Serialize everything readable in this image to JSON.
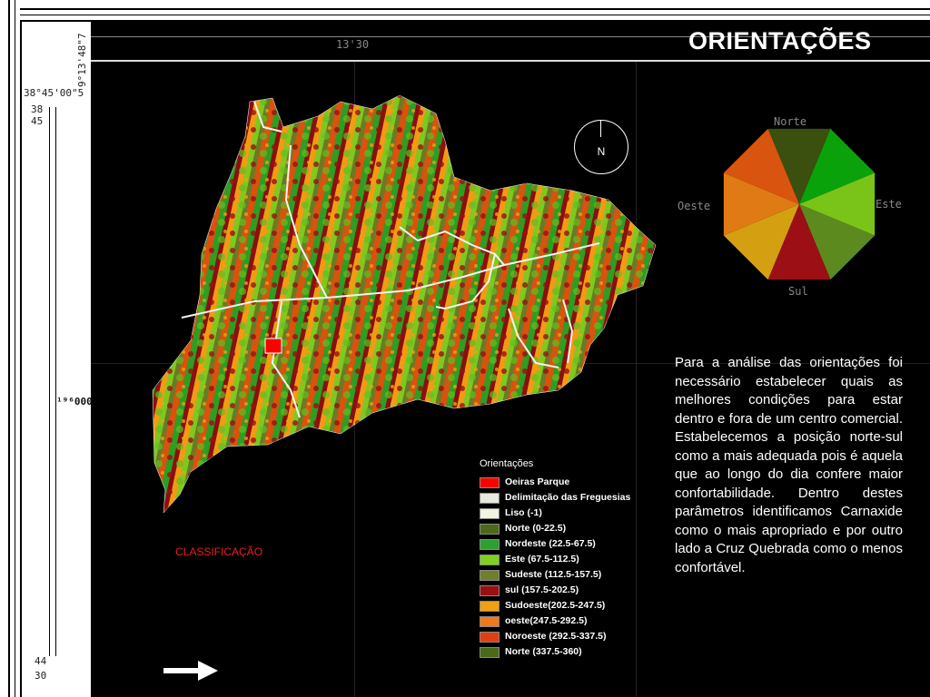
{
  "title": "ORIENTAÇÕES",
  "coords": {
    "lon_top": "13'30",
    "lon_left": "9°13'48\"7",
    "lat_top": "38°45'00\"5",
    "lat_38": "38",
    "lat_45": "45",
    "mid_left": "¹⁹⁶000",
    "bottom_44": "44",
    "bottom_30": "30"
  },
  "compass": {
    "label": "N"
  },
  "rose": {
    "labels": {
      "north": "Norte",
      "east": "Este",
      "south": "Sul",
      "west": "Oeste"
    },
    "sector_colors": [
      "#3b4f0f",
      "#0aa20a",
      "#7ac41a",
      "#5d8a1e",
      "#9c0f14",
      "#d4a012",
      "#e07a14",
      "#d9550f"
    ]
  },
  "paragraph": "Para a análise das orientações foi necessário estabelecer quais as melhores condições para estar dentro e fora de um centro comercial. Estabelecemos a posição norte-sul como a mais adequada pois é aquela que ao longo do dia confere maior confortabilidade. Dentro destes parâmetros identificamos Carnaxide como o mais apropriado e por outro lado a Cruz Quebrada como o menos confortável.",
  "legend": {
    "title": "Orientações",
    "items": [
      {
        "label": "Oeiras Parque",
        "color": "#ff0000"
      },
      {
        "label": "Delimitação das Freguesias",
        "color": "#e8e8e0"
      },
      {
        "label": "Liso (-1)",
        "color": "#f0f4e0"
      },
      {
        "label": "Norte (0-22.5)",
        "color": "#4a6a18"
      },
      {
        "label": "Nordeste (22.5-67.5)",
        "color": "#2fa02f"
      },
      {
        "label": "Este (67.5-112.5)",
        "color": "#7fd01f"
      },
      {
        "label": "Sudeste (112.5-157.5)",
        "color": "#6f7f2a"
      },
      {
        "label": "sul (157.5-202.5)",
        "color": "#9a0f12"
      },
      {
        "label": "Sudoeste(202.5-247.5)",
        "color": "#f0a010"
      },
      {
        "label": "oeste(247.5-292.5)",
        "color": "#f07818"
      },
      {
        "label": "Noroeste (292.5-337.5)",
        "color": "#e04010"
      },
      {
        "label": "Norte (337.5-360)",
        "color": "#4a6a18"
      }
    ]
  },
  "classification_label": "CLASSIFICAÇÃO"
}
